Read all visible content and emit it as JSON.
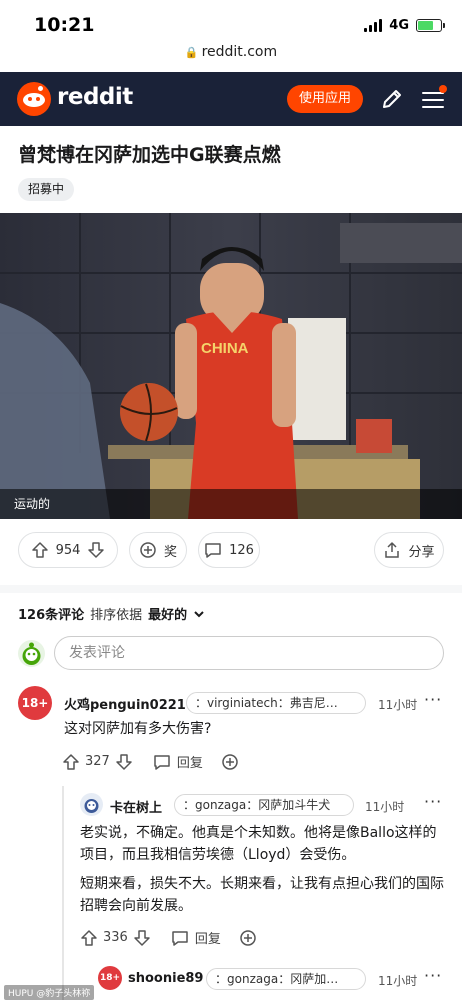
{
  "status_bar": {
    "time": "10:21",
    "network": "4G"
  },
  "browser": {
    "url": "reddit.com"
  },
  "header": {
    "brand": "reddit",
    "use_app_label": "使用应用"
  },
  "post": {
    "title": "曾梵博在冈萨加选中G联赛点燃",
    "flair": "招募中",
    "media_caption": "运动的",
    "jersey_text": "CHINA",
    "votes": "954",
    "award_label": "奖",
    "comments_count": "126",
    "share_label": "分享"
  },
  "comments_section": {
    "count_text": "126条评论",
    "sort_prefix": "排序依据",
    "sort_value": "最好的",
    "input_placeholder": "发表评论"
  },
  "comments": [
    {
      "avatar_text": "18+",
      "username": "火鸡penguin0221",
      "flair": "：virginiatech：弗吉尼…",
      "time": "11小时",
      "body": "这对冈萨加有多大伤害?",
      "votes": "327",
      "reply_label": "回复"
    },
    {
      "username": "卡在树上",
      "flair": "：gonzaga：冈萨加斗牛犬",
      "time": "11小时",
      "body_1": "老实说，不确定。他真是个未知数。他将是像Ballo这样的项目，而且我相信劳埃德（Lloyd）会受伤。",
      "body_2": "短期来看，损失不大。长期来看，让我有点担心我们的国际招聘会向前发展。",
      "votes": "336",
      "reply_label": "回复"
    },
    {
      "avatar_text": "18+",
      "username": "shoonie89",
      "flair": "：gonzaga：冈萨加…",
      "time": "11小时"
    }
  ],
  "watermark": "HUPU @豹子头林祢",
  "colors": {
    "header_bg": "#1a2238",
    "accent": "#ff4500",
    "nsfw": "#e03a3e"
  }
}
